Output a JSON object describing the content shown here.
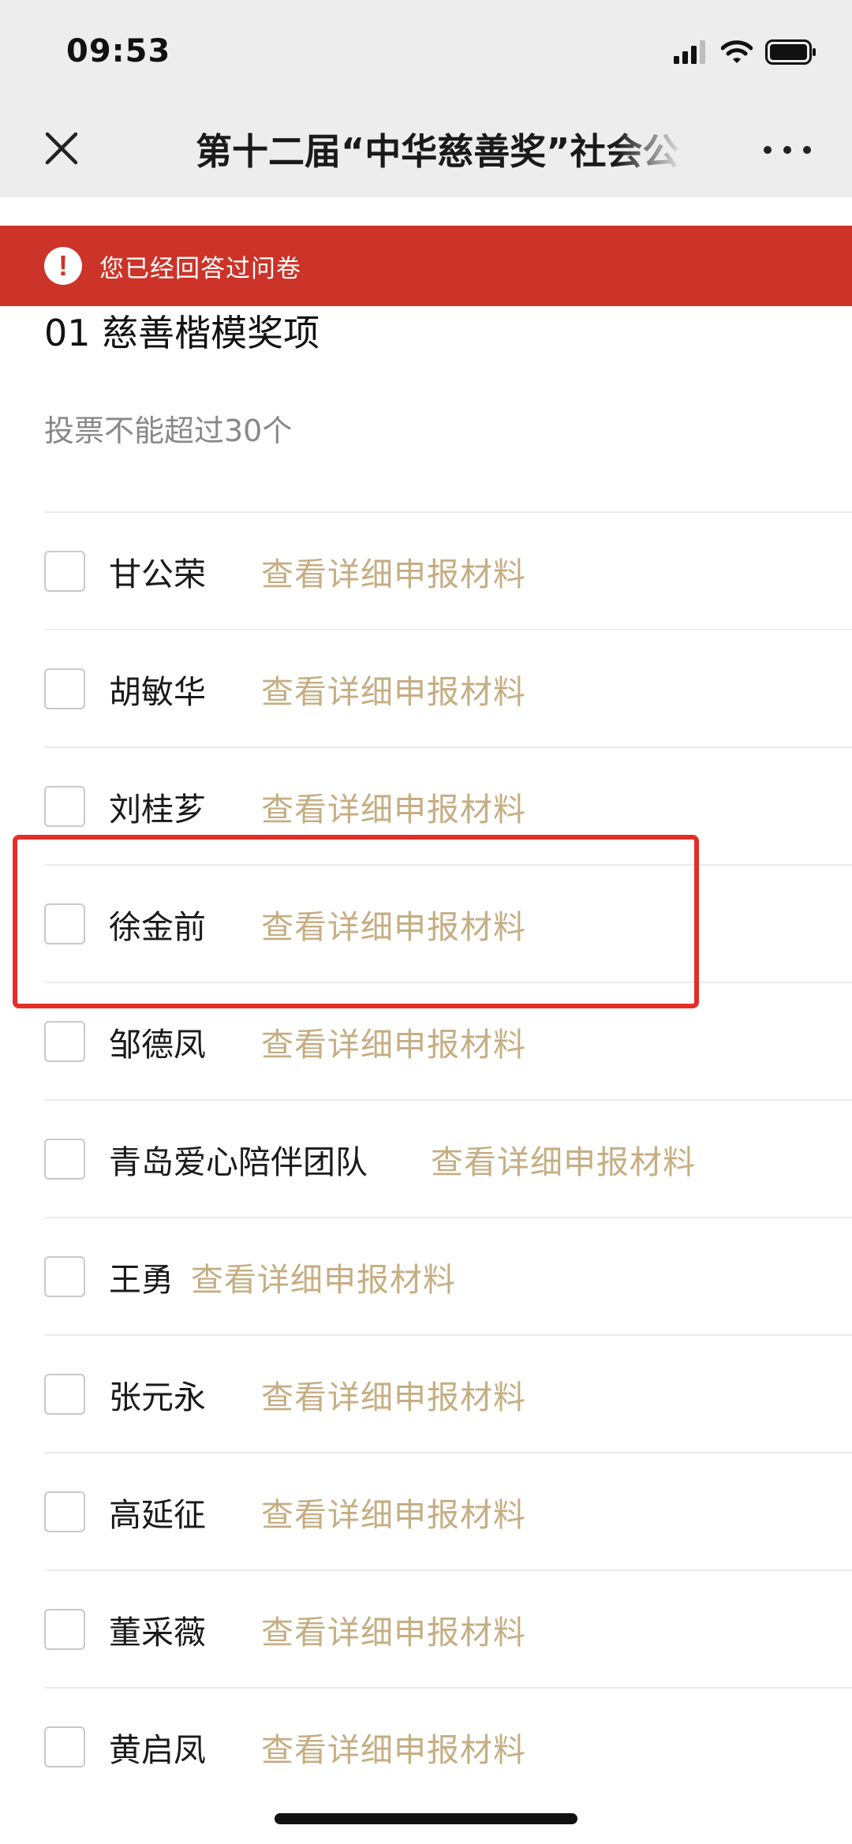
{
  "status_bar": {
    "time": "09:53",
    "icons": [
      "signal-icon",
      "wifi-icon",
      "battery-icon"
    ]
  },
  "nav": {
    "title": "第十二届“中华慈善奖”社会公",
    "close_icon": "close-icon",
    "more_icon": "more-icon"
  },
  "progress": {
    "fraction": 1.0
  },
  "banner": {
    "icon": "exclamation-icon",
    "icon_glyph": "!",
    "text": "您已经回答过问卷",
    "color": "#cc3329"
  },
  "question": {
    "title": "01 慈善楷模奖项",
    "hint": "投票不能超过30个"
  },
  "link_color": "#c5ae83",
  "options": [
    {
      "name": "甘公荣",
      "link": "查看详细申报材料",
      "checked": false
    },
    {
      "name": "胡敏华",
      "link": "查看详细申报材料",
      "checked": false
    },
    {
      "name": "刘桂芗",
      "link": "查看详细申报材料",
      "checked": false
    },
    {
      "name": "徐金前",
      "link": "查看详细申报材料",
      "checked": false
    },
    {
      "name": "邹德凤",
      "link": "查看详细申报材料",
      "checked": false
    },
    {
      "name": "青岛爱心陪伴团队",
      "link": "查看详细申报材料",
      "checked": false
    },
    {
      "name": "王勇",
      "link": "查看详细申报材料",
      "checked": false
    },
    {
      "name": "张元永",
      "link": "查看详细申报材料",
      "checked": false
    },
    {
      "name": "高延征",
      "link": "查看详细申报材料",
      "checked": false
    },
    {
      "name": "董采薇",
      "link": "查看详细申报材料",
      "checked": false
    },
    {
      "name": "黄启凤",
      "link": "查看详细申报材料",
      "checked": false
    }
  ],
  "highlight": {
    "option_index": 3,
    "color": "#e52d27"
  }
}
